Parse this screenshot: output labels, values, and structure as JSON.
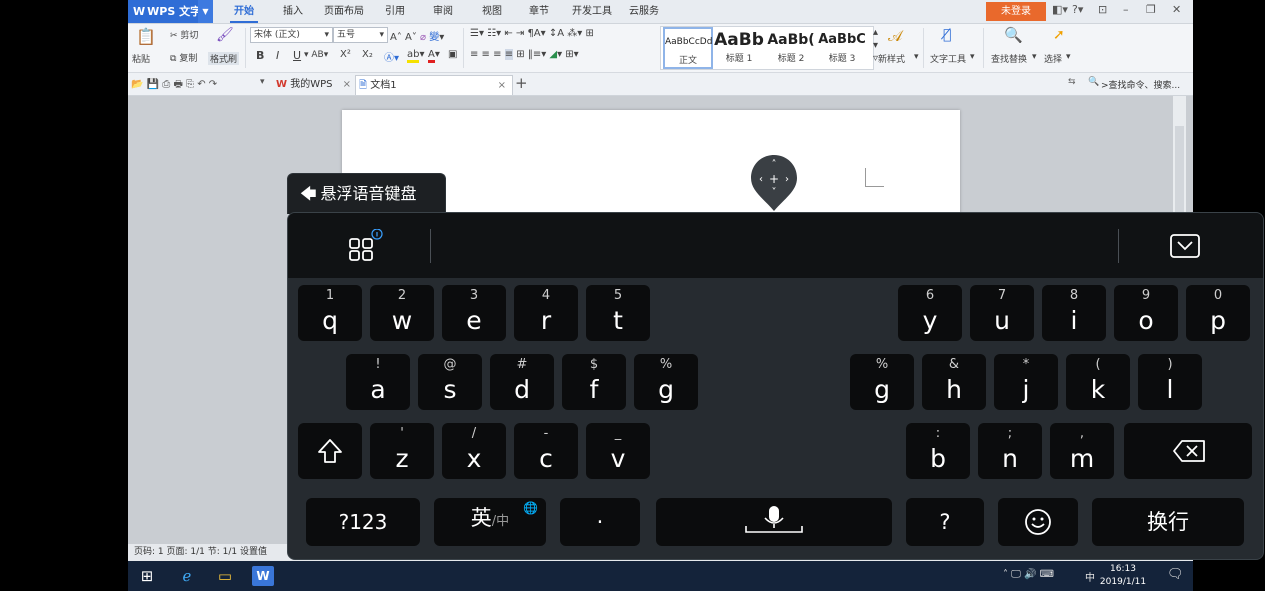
{
  "wps": {
    "app_name": "WPS 文字",
    "menu": [
      "开始",
      "插入",
      "页面布局",
      "引用",
      "审阅",
      "视图",
      "章节",
      "开发工具",
      "云服务"
    ],
    "login": "未登录",
    "window_controls": [
      "–",
      "❐",
      "✕"
    ],
    "ribbon": {
      "paste": "粘贴",
      "cut": "剪切",
      "copy": "复制",
      "format_painter": "格式刷",
      "font_name": "宋体 (正文)",
      "font_size": "五号",
      "styles": [
        {
          "sample": "AaBbCcDd",
          "name": "正文"
        },
        {
          "sample": "AaBb",
          "name": "标题 1"
        },
        {
          "sample": "AaBb(",
          "name": "标题 2"
        },
        {
          "sample": "AaBbC",
          "name": "标题 3"
        }
      ],
      "new_style": "新样式",
      "text_tools": "文字工具",
      "find_replace": "查找替换",
      "select": "选择"
    },
    "tabs": {
      "mywps": "我的WPS",
      "doc1": "文档1",
      "search": ">查找命令、搜索..."
    },
    "status": "页码: 1  页面: 1/1  节: 1/1  设置值"
  },
  "taskbar": {
    "time": "16:13",
    "date": "2019/1/11",
    "ime": "中"
  },
  "keyboard": {
    "title": "悬浮语音键盘",
    "row1_left": [
      {
        "hint": "1",
        "key": "q"
      },
      {
        "hint": "2",
        "key": "w"
      },
      {
        "hint": "3",
        "key": "e"
      },
      {
        "hint": "4",
        "key": "r"
      },
      {
        "hint": "5",
        "key": "t"
      }
    ],
    "row1_right": [
      {
        "hint": "6",
        "key": "y"
      },
      {
        "hint": "7",
        "key": "u"
      },
      {
        "hint": "8",
        "key": "i"
      },
      {
        "hint": "9",
        "key": "o"
      },
      {
        "hint": "0",
        "key": "p"
      }
    ],
    "row2_left": [
      {
        "hint": "!",
        "key": "a"
      },
      {
        "hint": "@",
        "key": "s"
      },
      {
        "hint": "#",
        "key": "d"
      },
      {
        "hint": "$",
        "key": "f"
      },
      {
        "hint": "%",
        "key": "g"
      }
    ],
    "row2_right": [
      {
        "hint": "%",
        "key": "g"
      },
      {
        "hint": "&",
        "key": "h"
      },
      {
        "hint": "*",
        "key": "j"
      },
      {
        "hint": "(",
        "key": "k"
      },
      {
        "hint": ")",
        "key": "l"
      }
    ],
    "row3_left": [
      {
        "hint": "'",
        "key": "z"
      },
      {
        "hint": "/",
        "key": "x"
      },
      {
        "hint": "-",
        "key": "c"
      },
      {
        "hint": "_",
        "key": "v"
      }
    ],
    "row3_right": [
      {
        "hint": ":",
        "key": "b"
      },
      {
        "hint": ";",
        "key": "n"
      },
      {
        "hint": ",",
        "key": "m"
      }
    ],
    "bottom": {
      "symbols": "?123",
      "lang_main": "英",
      "lang_sub": "/中",
      "dot": "·",
      "question": "?",
      "enter": "换行"
    }
  }
}
